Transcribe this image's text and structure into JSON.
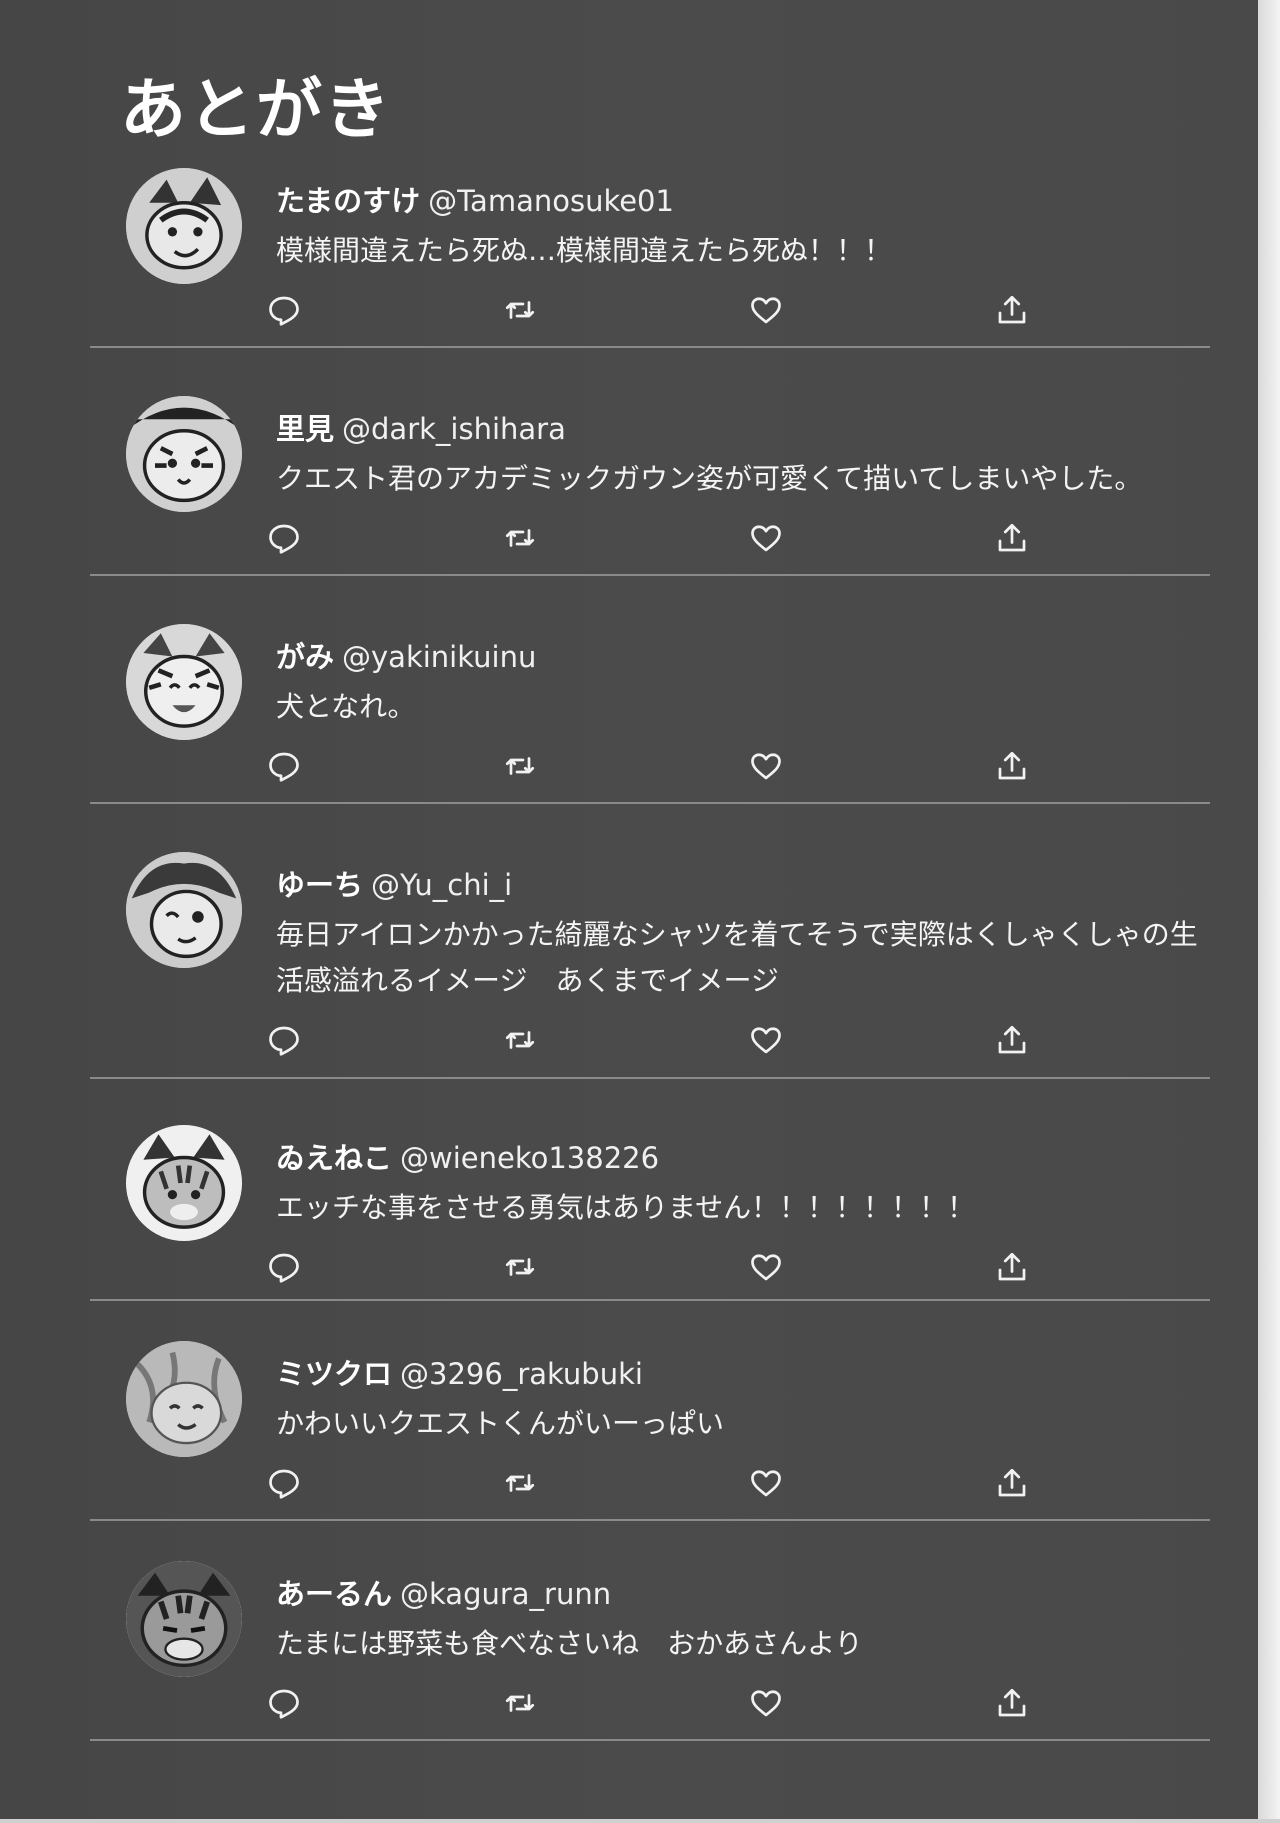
{
  "page_title": "あとがき",
  "tweets": [
    {
      "name": "たまのすけ",
      "handle": "@Tamanosuke01",
      "text": "模様間違えたら死ぬ…模様間違えたら死ぬ！！！"
    },
    {
      "name": "里見",
      "handle": "@dark_ishihara",
      "text": "クエスト君のアカデミックガウン姿が可愛くて描いてしまいやした。"
    },
    {
      "name": "がみ",
      "handle": "@yakinikuinu",
      "text": "犬となれ。"
    },
    {
      "name": "ゆーち",
      "handle": "@Yu_chi_i",
      "text": "毎日アイロンかかった綺麗なシャツを着てそうで実際はくしゃくしゃの生活感溢れるイメージ　あくまでイメージ"
    },
    {
      "name": "ゐえねこ",
      "handle": "@wieneko138226",
      "text": "エッチな事をさせる勇気はありません！！！！！！！！"
    },
    {
      "name": "ミツクロ",
      "handle": "@3296_rakubuki",
      "text": "かわいいクエストくんがいーっぱい"
    },
    {
      "name": "あーるん",
      "handle": "@kagura_runn",
      "text": "たまには野菜も食べなさいね　おかあさんより"
    }
  ],
  "icons": {
    "reply": "reply-icon",
    "retweet": "retweet-icon",
    "like": "like-icon",
    "share": "share-icon"
  },
  "colors": {
    "background": "#4a4a4a",
    "text": "#f2f2f2",
    "divider": "#8a8a8a"
  }
}
